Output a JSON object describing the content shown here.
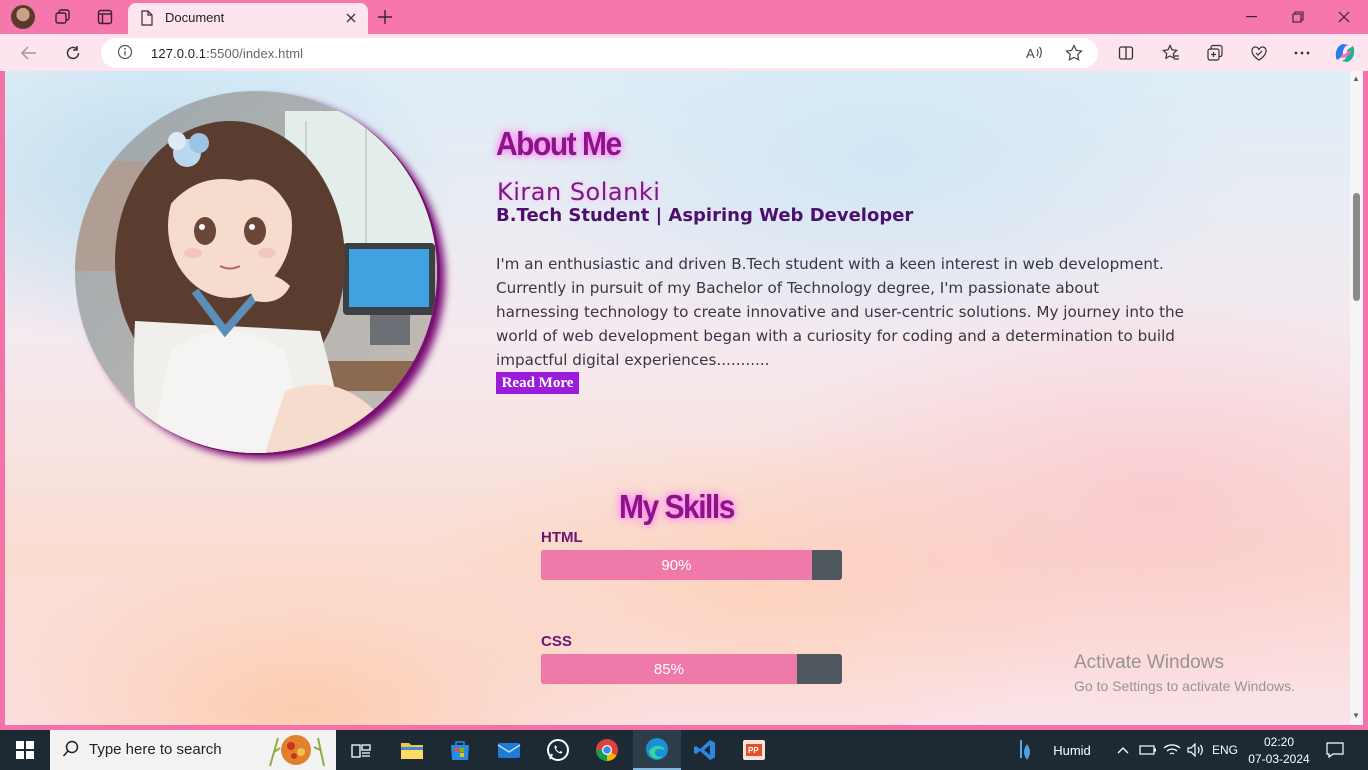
{
  "browser": {
    "tab_title": "Document",
    "url_host": "127.0.0.1",
    "url_path": ":5500/index.html"
  },
  "page": {
    "about_title": "About Me",
    "name": "Kiran Solanki",
    "subtitle": "B.Tech Student | Aspiring Web Developer",
    "bio": "I'm an enthusiastic and driven B.Tech student with a keen interest in web development. Currently in pursuit of my Bachelor of Technology degree, I'm passionate about harnessing technology to create innovative and user-centric solutions. My journey into the world of web development began with a curiosity for coding and a determination to build impactful digital experiences...........",
    "read_more": "Read More",
    "skills_title": "My Skills",
    "skills": [
      {
        "label": "HTML",
        "percent_text": "90%",
        "value": 90
      },
      {
        "label": "CSS",
        "percent_text": "85%",
        "value": 85
      }
    ]
  },
  "watermark": {
    "line1": "Activate Windows",
    "line2": "Go to Settings to activate Windows."
  },
  "taskbar": {
    "search_placeholder": "Type here to search",
    "weather": "Humid",
    "language": "ENG",
    "time": "02:20",
    "date": "07-03-2024"
  },
  "colors": {
    "accent_pink": "#ef79a8",
    "heading_purple": "#8a1488",
    "button_purple": "#9b1ddc",
    "bar_track": "#4e565e"
  }
}
